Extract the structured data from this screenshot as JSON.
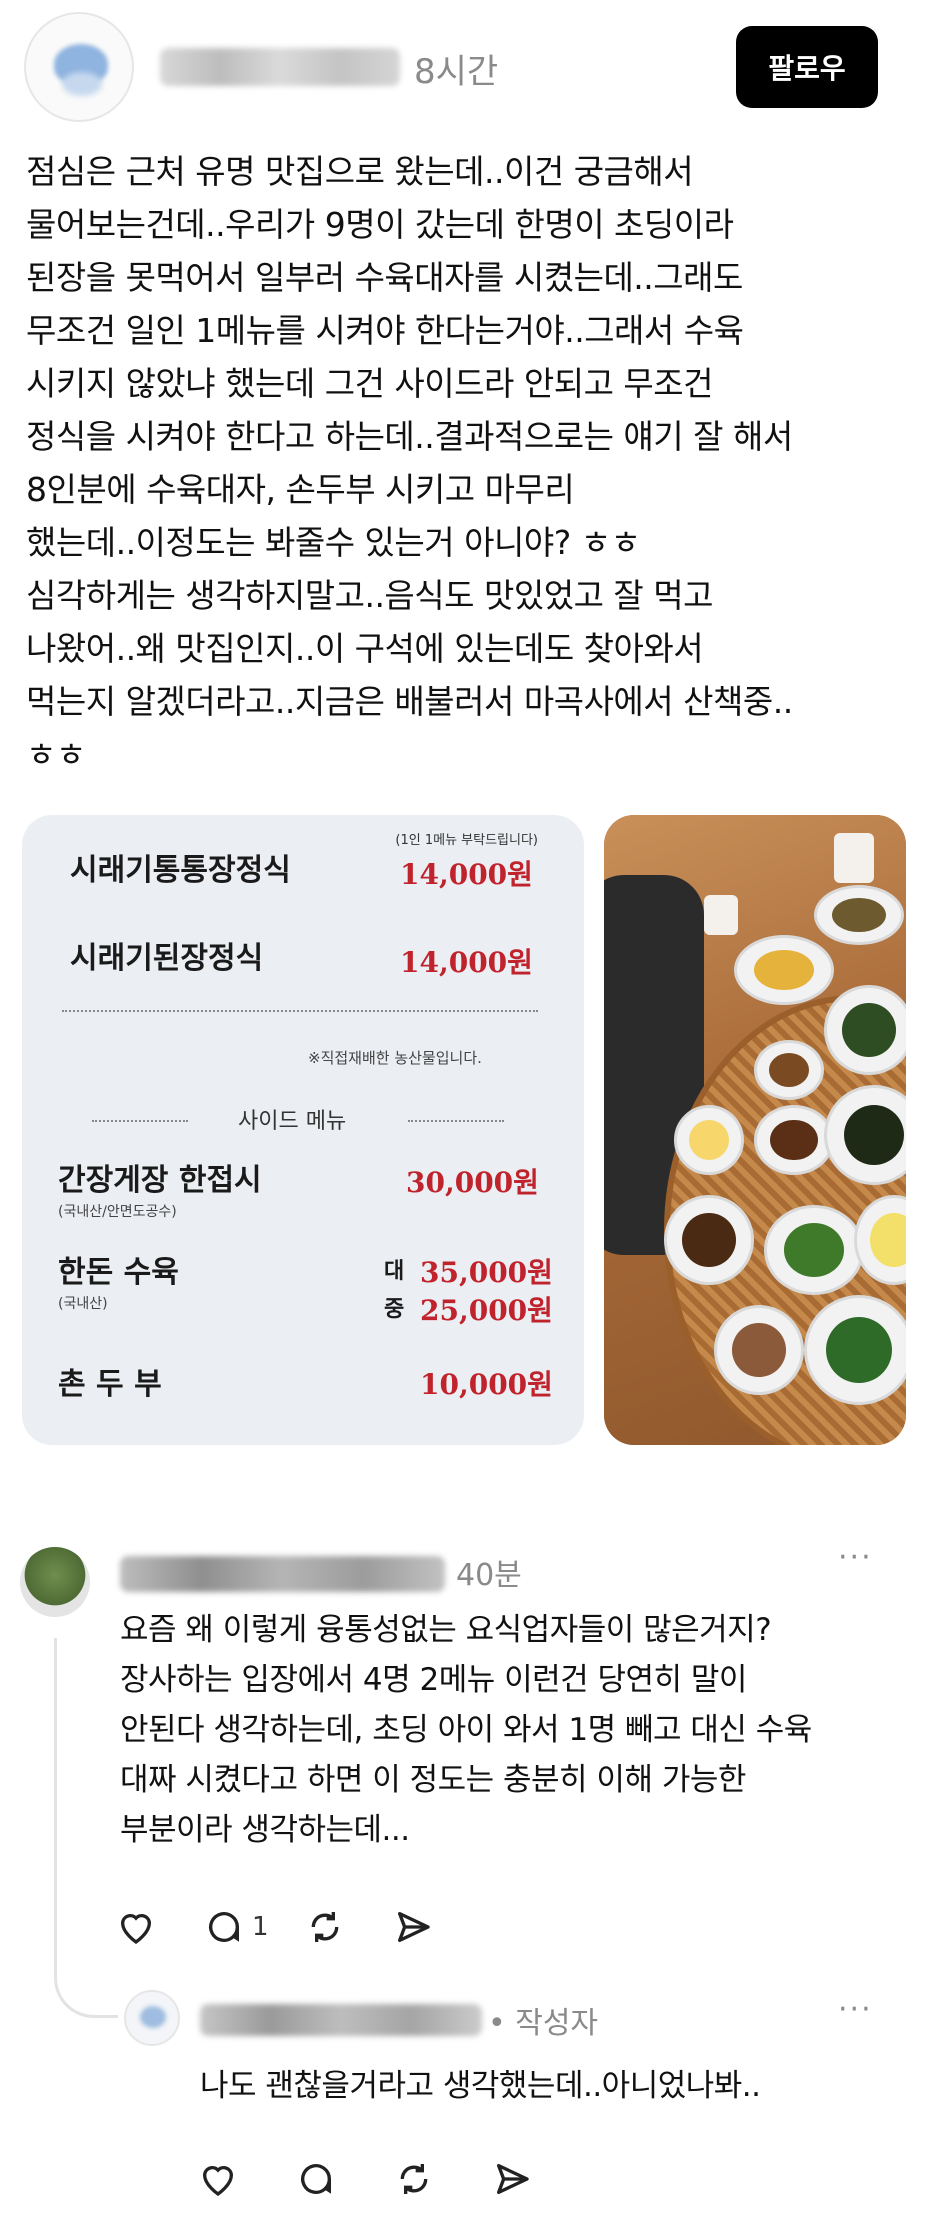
{
  "post": {
    "time": "8시간",
    "follow_label": "팔로우",
    "lines": [
      "점심은 근처 유명 맛집으로 왔는데..이건 궁금해서",
      "물어보는건데..우리가 9명이 갔는데 한명이 초딩이라",
      "된장을 못먹어서 일부러 수육대자를 시켰는데..그래도",
      "무조건 일인 1메뉴를 시켜야 한다는거야..그래서 수육",
      "시키지 않았냐 했는데 그건 사이드라 안되고 무조건",
      "정식을 시켜야 한다고 하는데..결과적으로는 얘기 잘 해서",
      "8인분에 수육대자, 손두부 시키고 마무리",
      "했는데..이정도는 봐줄수 있는거 아니야? ㅎㅎ",
      "심각하게는 생각하지말고..음식도 맛있었고 잘 먹고",
      "나왔어..왜 맛집인지..이 구석에 있는데도 찾아와서",
      "먹는지 알겠더라고..지금은 배불러서 마곡사에서 산책중..",
      "ㅎㅎ"
    ]
  },
  "menu_image": {
    "note": "(1인 1메뉴 부탁드립니다)",
    "main_items": [
      {
        "name": "시래기통통장정식",
        "price": "14,000원"
      },
      {
        "name": "시래기된장정식",
        "price": "14,000원"
      }
    ],
    "origin_note": "※직접재배한 농산물입니다.",
    "side_label": "사이드 메뉴",
    "side_items": {
      "gejang": {
        "name": "간장게장 한접시",
        "sub": "(국내산/안면도공수)",
        "price": "30,000원"
      },
      "suyuk": {
        "name": "한돈 수육",
        "sub": "(국내산)",
        "size_large": "대",
        "price_large": "35,000원",
        "size_medium": "중",
        "price_medium": "25,000원"
      },
      "tofu": {
        "name": "촌 두 부",
        "price": "10,000원"
      }
    }
  },
  "comment": {
    "time": "40분",
    "more": "···",
    "lines": [
      "요즘 왜 이렇게 융통성없는 요식업자들이 많은거지?",
      "장사하는 입장에서 4명 2메뉴 이런건 당연히 말이",
      "안된다 생각하는데, 초딩 아이 와서 1명 빼고 대신 수육",
      "대짜 시켰다고 하면 이 정도는 충분히 이해 가능한",
      "부분이라 생각하는데..."
    ],
    "reply_count": "1"
  },
  "reply": {
    "author_badge": "• 작성자",
    "more": "···",
    "text": "나도 괜찮을거라고 생각했는데..아니었나봐.."
  },
  "icons": {
    "like": "heart-icon",
    "reply": "comment-bubble-icon",
    "repost": "repost-icon",
    "share": "send-icon"
  }
}
